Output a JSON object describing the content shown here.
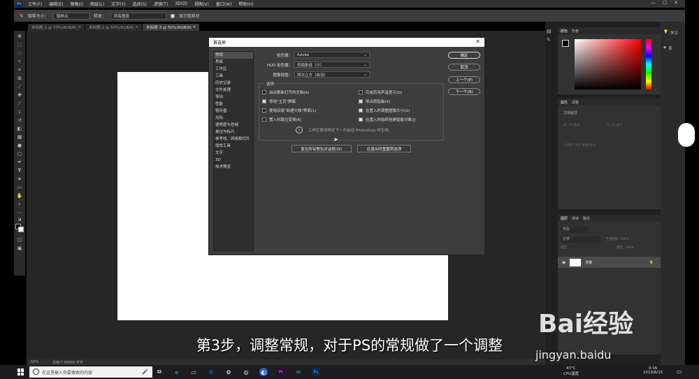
{
  "menubar": {
    "items": [
      "文件(F)",
      "编辑(E)",
      "图像(I)",
      "图层(L)",
      "文字(Y)",
      "选择(S)",
      "滤镜(T)",
      "3D(D)",
      "视图(V)",
      "窗口(W)",
      "帮助(H)"
    ]
  },
  "optbar": {
    "sample_size_label": "取样大小：",
    "sample_size_value": "取样点",
    "sample_label": "样本：",
    "sample_value": "所有图层",
    "show_ring_label": "显示取样环"
  },
  "tabs": [
    "未标题-1 @ 50%(RGB/8)",
    "未标题-2 @ 50%(RGB/8)",
    "未标题-3 @ 50%(RGB/8)"
  ],
  "statusbar": {
    "zoom": "50%",
    "doc": "文档:7.66M/0 字节"
  },
  "panels": {
    "color_tabs": [
      "颜色",
      "色板"
    ],
    "props_tabs": [
      "属性",
      "调整"
    ],
    "props_doc": "文档属性",
    "props_w": "W: 19 厘米",
    "props_h": "H: 13 厘米",
    "props_res": "分辨率: 300 像素/英寸",
    "layers_tabs": [
      "图层",
      "通道",
      "路径"
    ],
    "layers_kind": "类型",
    "layers_mode": "正常",
    "layers_opacity": "不透明度: 100%",
    "layers_lock": "锁定:",
    "layers_fill": "填充: 100%",
    "layer_name": "背景",
    "learn": "学习",
    "library": "库"
  },
  "dialog": {
    "title": "首选项",
    "nav": [
      "常规",
      "界面",
      "工作区",
      "工具",
      "历史记录",
      "文件处理",
      "导出",
      "性能",
      "暂存盘",
      "光标",
      "透明度与色域",
      "单位与标尺",
      "参考线、网格和切片",
      "增效工具",
      "文字",
      "3D",
      "技术预览"
    ],
    "color_picker_label": "拾色器：",
    "color_picker_value": "Adobe",
    "hud_label": "HUD 拾色器：",
    "hud_value": "色相条纹（小）",
    "interp_label": "图像插值：",
    "interp_value": "两次立方（自动）",
    "options_legend": "选项",
    "opts_left": [
      {
        "label": "自动更新打开的文档(A)",
        "checked": false
      },
      {
        "label": "停用\"主页\"屏幕",
        "checked": true
      },
      {
        "label": "使用旧版\"新建文档\"界面(L)",
        "checked": false
      },
      {
        "label": "置入时跳过变换(K)",
        "checked": false
      }
    ],
    "opts_right": [
      {
        "label": "完成后用声音提示(D)",
        "checked": false
      },
      {
        "label": "导出剪贴板(X)",
        "checked": true
      },
      {
        "label": "在置入时调整图像大小(G)",
        "checked": true
      },
      {
        "label": "在置入时始终创建智能对象(J)",
        "checked": true
      }
    ],
    "info": "工作区更改将在下一次启动 Photoshop 时生效。",
    "reset_warn": "复位所有警告对话框(W)",
    "reset_exit": "在退出时重置首选项",
    "ok": "确定",
    "cancel": "取消",
    "prev": "上一个(P)",
    "next": "下一个(N)"
  },
  "taskbar": {
    "search_placeholder": "在这里输入你要搜索的内容",
    "temp": "47°C",
    "temp_label": "CPU温度",
    "time": "0:16",
    "date": "2019/8/15"
  },
  "overlay": {
    "subtitle": "第3步，调整常规，对于PS的常规做了一个调整",
    "watermark_brand": "Bai经验",
    "watermark_url": "jingyan.baidu"
  }
}
